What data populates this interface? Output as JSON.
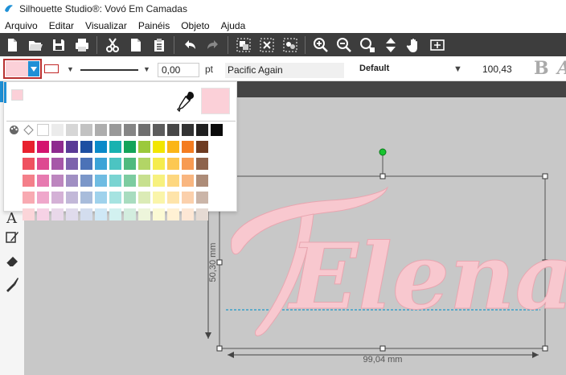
{
  "window": {
    "title": "Silhouette Studio®: Vovó Em Camadas"
  },
  "menu": [
    "Arquivo",
    "Editar",
    "Visualizar",
    "Painéis",
    "Objeto",
    "Ajuda"
  ],
  "toolbar": {
    "icons": [
      "new-icon",
      "open-icon",
      "save-icon",
      "print-icon",
      "cut-icon",
      "copy-icon",
      "paste-icon",
      "undo-icon",
      "redo-icon",
      "group-icon",
      "ungroup-icon",
      "select-all-icon",
      "zoom-in-icon",
      "zoom-out-icon",
      "zoom-fit-icon",
      "move-icon",
      "pan-icon",
      "fit-page-icon"
    ]
  },
  "properties": {
    "fill_color": "#fbd0d8",
    "line_color": "#c12828",
    "line_width": "0,00",
    "line_unit": "pt",
    "font_name": "Pacific Again",
    "font_style": "Default",
    "font_size": "100,43",
    "bold_label": "B",
    "italic_label": "A"
  },
  "color_panel": {
    "current_color": "#fbd0d8",
    "rows": [
      [
        "#ffffff",
        "#ebebeb",
        "#d6d6d6",
        "#c2c2c2",
        "#adadad",
        "#999999",
        "#858585",
        "#707070",
        "#5c5c5c",
        "#474747",
        "#333333",
        "#1f1f1f",
        "#0a0a0a"
      ],
      [
        "#e8212f",
        "#d4146f",
        "#8e2a8f",
        "#5a3a96",
        "#1d4fa2",
        "#0a8ac9",
        "#18b2b0",
        "#13a45a",
        "#9bc93b",
        "#f2e600",
        "#fbb517",
        "#f47c20",
        "#6e3b21"
      ],
      [
        "#ef5160",
        "#de4a91",
        "#a657a8",
        "#7d63ad",
        "#4b72b7",
        "#3ba3d7",
        "#4cc4c2",
        "#4fba7e",
        "#b2d566",
        "#f5ec4c",
        "#fcc852",
        "#f79a52",
        "#8e634c"
      ],
      [
        "#f47f8a",
        "#e77ab0",
        "#bd86bf",
        "#a08fc3",
        "#7b97c9",
        "#6fbce2",
        "#7ad4d2",
        "#7ccca0",
        "#c7e08f",
        "#f7f17e",
        "#fdd77f",
        "#f9b680",
        "#ad8c78"
      ],
      [
        "#f8aab2",
        "#efa7cb",
        "#d4b1d6",
        "#c2b8d8",
        "#a8bcdb",
        "#9fd2ec",
        "#a6e3e1",
        "#a8dcbf",
        "#dbebb6",
        "#faf5aa",
        "#fee4aa",
        "#fbd0ac",
        "#cbb5a8"
      ],
      [
        "#fbd5d9",
        "#f6d2e5",
        "#e9d8ea",
        "#e0dbec",
        "#d3ddee",
        "#cfe8f6",
        "#d2f1f0",
        "#d3eddf",
        "#edf5db",
        "#fcfad4",
        "#fff1d4",
        "#fde7d5",
        "#e5dad3"
      ]
    ]
  },
  "canvas": {
    "text": "Elena",
    "height_label": "50,30 mm",
    "width_label": "99,04 mm"
  }
}
